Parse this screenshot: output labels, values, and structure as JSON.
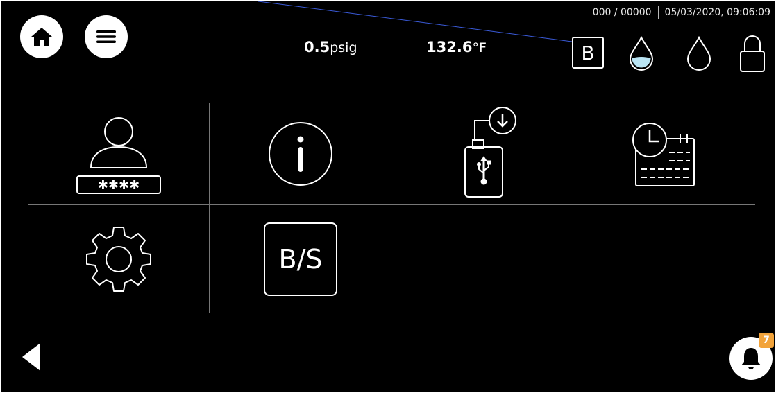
{
  "header": {
    "counter": "000 / 00000",
    "datetime": "05/03/2020, 09:06:09",
    "pressure_value": "0.5",
    "pressure_unit": "psig",
    "temperature_value": "132.6",
    "temperature_unit": "°F",
    "mode_label": "B"
  },
  "icons": {
    "home": "home-icon",
    "menu": "menu-icon",
    "water_filled": "water-drop-filled-icon",
    "water_empty": "water-drop-empty-icon",
    "lock": "lock-icon",
    "back": "back-arrow-icon",
    "notification": "bell-icon"
  },
  "tiles": [
    {
      "name": "user-login-tile",
      "icon": "user-password-icon"
    },
    {
      "name": "information-tile",
      "icon": "info-icon"
    },
    {
      "name": "usb-download-tile",
      "icon": "usb-download-icon"
    },
    {
      "name": "schedule-tile",
      "icon": "calendar-clock-icon"
    },
    {
      "name": "settings-tile",
      "icon": "gear-icon"
    },
    {
      "name": "bs-mode-tile",
      "icon": "bs-mode-icon",
      "label": "B/S"
    }
  ],
  "notifications": {
    "count": "7"
  },
  "colors": {
    "background": "#000000",
    "foreground": "#ffffff",
    "water_fill": "#b9e4f3",
    "badge": "#f2a33a",
    "pointer_line": "#3a5ad8"
  }
}
